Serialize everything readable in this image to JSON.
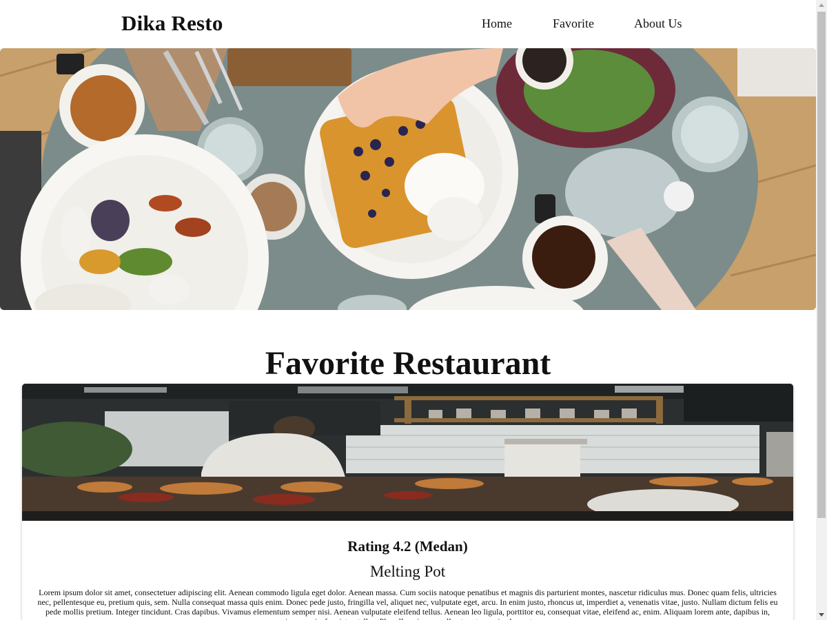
{
  "navbar": {
    "brand": "Dika Resto",
    "links": [
      {
        "label": "Home"
      },
      {
        "label": "Favorite"
      },
      {
        "label": "About Us"
      }
    ]
  },
  "main": {
    "section_title": "Favorite Restaurant",
    "restaurants": [
      {
        "rating_text": "Rating 4.2 (Medan)",
        "name": "Melting Pot",
        "description": "Lorem ipsum dolor sit amet, consectetuer adipiscing elit. Aenean commodo ligula eget dolor. Aenean massa. Cum sociis natoque penatibus et magnis dis parturient montes, nascetur ridiculus mus. Donec quam felis, ultricies nec, pellentesque eu, pretium quis, sem. Nulla consequat massa quis enim. Donec pede justo, fringilla vel, aliquet nec, vulputate eget, arcu. In enim justo, rhoncus ut, imperdiet a, venenatis vitae, justo. Nullam dictum felis eu pede mollis pretium. Integer tincidunt. Cras dapibus. Vivamus elementum semper nisi. Aenean vulputate eleifend tellus. Aenean leo ligula, porttitor eu, consequat vitae, eleifend ac, enim. Aliquam lorem ante, dapibus in, viverra quis, feugiat a, tellus. Phasellus viverra nulla ut metus varius laoreet."
      }
    ]
  },
  "icons": {
    "scroll_up": "triangle-up-icon",
    "scroll_down": "triangle-down-icon"
  }
}
